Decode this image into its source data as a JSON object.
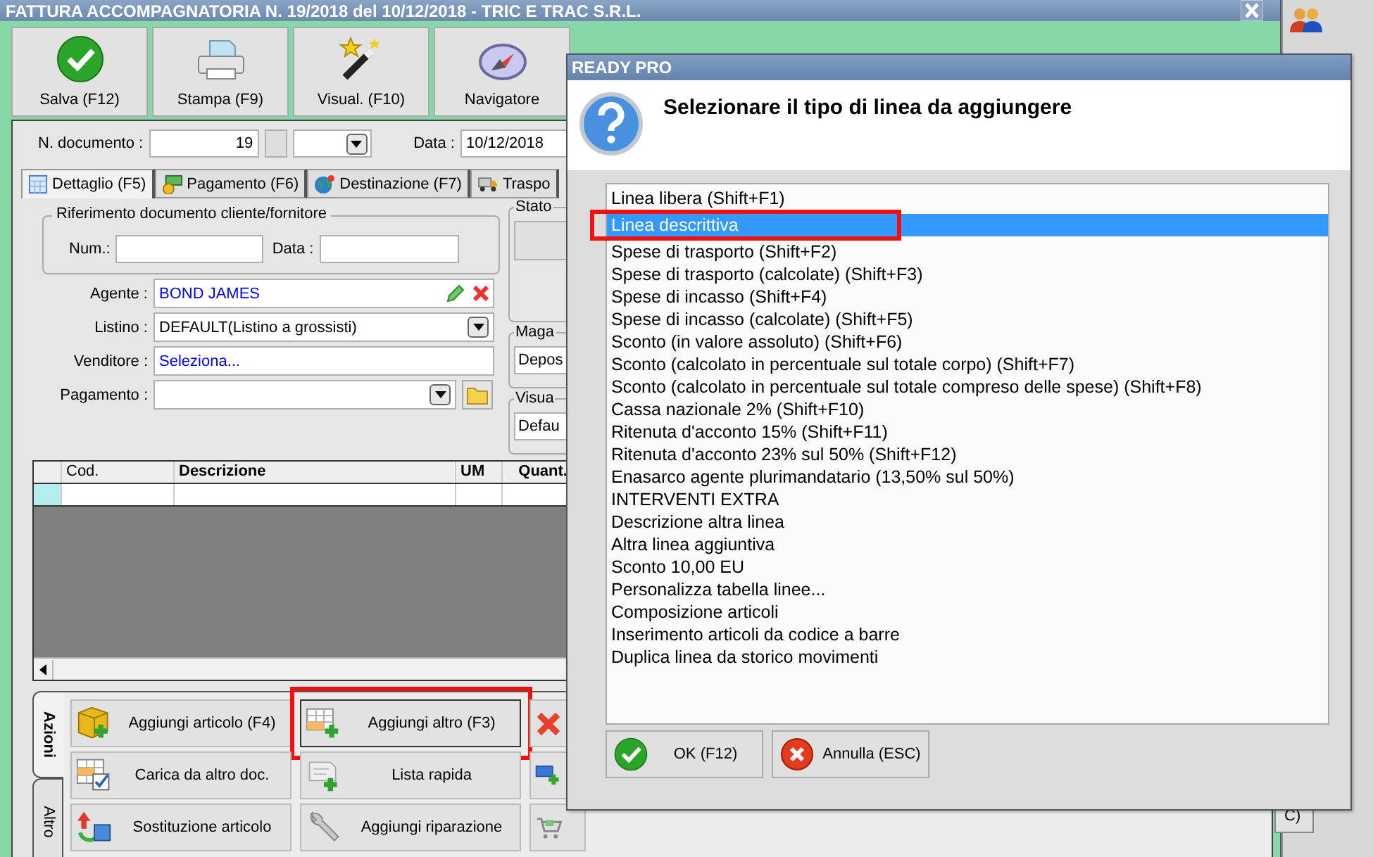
{
  "window": {
    "title": "FATTURA ACCOMPAGNATORIA N. 19/2018 del 10/12/2018 - TRIC E TRAC S.R.L."
  },
  "toolbar": [
    {
      "label": "Salva (F12)"
    },
    {
      "label": "Stampa (F9)"
    },
    {
      "label": "Visual. (F10)"
    },
    {
      "label": "Navigatore"
    }
  ],
  "document": {
    "number_label": "N. documento :",
    "number": "19",
    "date_label": "Data :",
    "date": "10/12/2018"
  },
  "tabs": [
    {
      "label": "Dettaglio (F5)",
      "selected": true
    },
    {
      "label": "Pagamento (F6)",
      "selected": false
    },
    {
      "label": "Destinazione (F7)",
      "selected": false
    },
    {
      "label": "Traspo",
      "selected": false
    }
  ],
  "reference": {
    "title": "Riferimento documento cliente/fornitore",
    "num_label": "Num.:",
    "date_label": "Data :"
  },
  "fields": [
    {
      "label": "Agente :",
      "value": "BOND JAMES",
      "kind": "lookup"
    },
    {
      "label": "Listino :",
      "value": "DEFAULT(Listino a grossisti)",
      "kind": "dropdown"
    },
    {
      "label": "Venditore :",
      "value": "Seleziona...",
      "kind": "link"
    },
    {
      "label": "Pagamento :",
      "kind": "dropdown_folder"
    }
  ],
  "side_groups": [
    {
      "title": "Stato"
    },
    {
      "title": "Maga",
      "value": "Depos"
    },
    {
      "title": "Visua",
      "value": "Defau"
    }
  ],
  "grid": {
    "columns": [
      "Cod.",
      "Descrizione",
      "UM",
      "Quant."
    ]
  },
  "action_tabs": [
    {
      "label": "Azioni",
      "selected": true
    },
    {
      "label": "Altro",
      "selected": false
    }
  ],
  "actions": [
    {
      "label": "Aggiungi articolo (F4)",
      "highlighted": false
    },
    {
      "label": "Aggiungi altro (F3)",
      "highlighted": true
    },
    {
      "highlighted": false
    },
    {
      "label": "Carica da altro doc.",
      "highlighted": false
    },
    {
      "label": "Lista rapida",
      "highlighted": false
    },
    {
      "highlighted": false
    },
    {
      "label": "Sostituzione articolo",
      "highlighted": false
    },
    {
      "label": "Aggiungi riparazione",
      "highlighted": false
    },
    {
      "highlighted": false
    }
  ],
  "side_button": "C)",
  "dialog": {
    "title": "READY PRO",
    "message": "Selezionare il tipo di linea da aggiungere",
    "options": [
      {
        "label": "Linea libera (Shift+F1)",
        "selected": false,
        "highlighted": false
      },
      {
        "label": "Linea descrittiva",
        "selected": true,
        "highlighted": true
      },
      {
        "label": "Spese di trasporto (Shift+F2)",
        "selected": false,
        "highlighted": false
      },
      {
        "label": "Spese di trasporto (calcolate) (Shift+F3)",
        "selected": false,
        "highlighted": false
      },
      {
        "label": "Spese di incasso (Shift+F4)",
        "selected": false,
        "highlighted": false
      },
      {
        "label": "Spese di incasso (calcolate) (Shift+F5)",
        "selected": false,
        "highlighted": false
      },
      {
        "label": "Sconto (in valore assoluto) (Shift+F6)",
        "selected": false,
        "highlighted": false
      },
      {
        "label": "Sconto (calcolato in percentuale sul totale corpo) (Shift+F7)",
        "selected": false,
        "highlighted": false
      },
      {
        "label": "Sconto (calcolato in percentuale sul totale compreso delle spese) (Shift+F8)",
        "selected": false,
        "highlighted": false
      },
      {
        "label": "Cassa nazionale 2% (Shift+F10)",
        "selected": false,
        "highlighted": false
      },
      {
        "label": "Ritenuta d'acconto 15% (Shift+F11)",
        "selected": false,
        "highlighted": false
      },
      {
        "label": "Ritenuta d'acconto 23% sul 50% (Shift+F12)",
        "selected": false,
        "highlighted": false
      },
      {
        "label": "Enasarco agente plurimandatario (13,50% sul 50%)",
        "selected": false,
        "highlighted": false
      },
      {
        "label": "INTERVENTI EXTRA",
        "selected": false,
        "highlighted": false
      },
      {
        "label": "Descrizione altra linea",
        "selected": false,
        "highlighted": false
      },
      {
        "label": "Altra linea aggiuntiva",
        "selected": false,
        "highlighted": false
      },
      {
        "label": "Sconto 10,00 EU",
        "selected": false,
        "highlighted": false
      },
      {
        "label": "Personalizza tabella linee...",
        "selected": false,
        "highlighted": false
      },
      {
        "label": "Composizione articoli",
        "selected": false,
        "highlighted": false
      },
      {
        "label": "Inserimento articoli da codice a barre",
        "selected": false,
        "highlighted": false
      },
      {
        "label": "Duplica linea da storico movimenti",
        "selected": false,
        "highlighted": false
      }
    ],
    "buttons": [
      {
        "label": "OK (F12)",
        "kind": "ok"
      },
      {
        "label": "Annulla (ESC)",
        "kind": "cancel"
      }
    ]
  }
}
